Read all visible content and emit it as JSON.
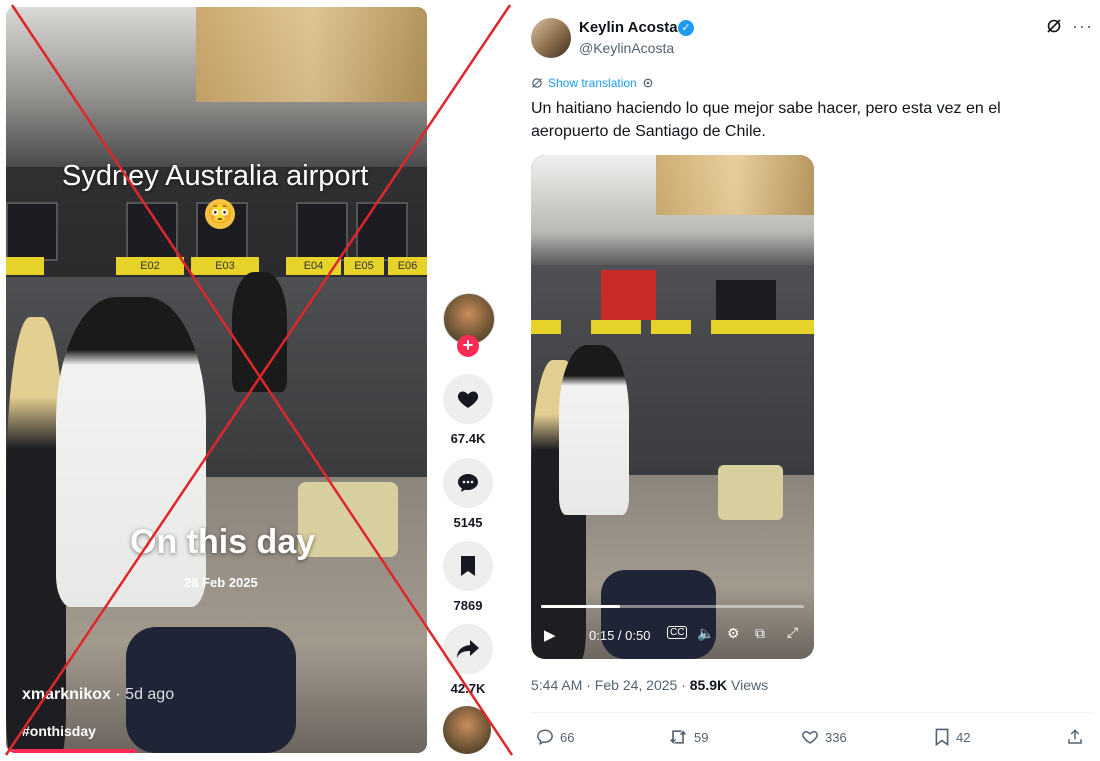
{
  "tiktok": {
    "overlay_title": "Sydney Australia airport",
    "emoji": "😳",
    "counter_labels": [
      "E02",
      "E03",
      "E04",
      "E05",
      "E06"
    ],
    "on_this_day": "On this day",
    "date": "28 Feb 2025",
    "author": "xmarknikox",
    "author_time": "· 5d ago",
    "hashtag": "#onthisday",
    "likes": "67.4K",
    "comments": "5145",
    "saves": "7869",
    "shares": "42.7K",
    "follow_icon": "+",
    "accent": "#fe2c55"
  },
  "x_post": {
    "display_name": "Keylin Acosta",
    "handle": "@KeylinAcosta",
    "show_translation": "Show translation",
    "text": "Un haitiano haciendo lo que mejor sabe hacer, pero esta vez en el aeropuerto de Santiago de Chile.",
    "video_time": "0:15 / 0:50",
    "video_progress": 0.3,
    "timestamp": "5:44 AM · Feb 24, 2025 · ",
    "views_count": "85.9K",
    "views_label": " Views",
    "replies": "66",
    "reposts": "59",
    "likes": "336",
    "bookmarks": "42",
    "accent": "#1d9bf0"
  },
  "overlay": {
    "cross_color": "#e0262b"
  }
}
